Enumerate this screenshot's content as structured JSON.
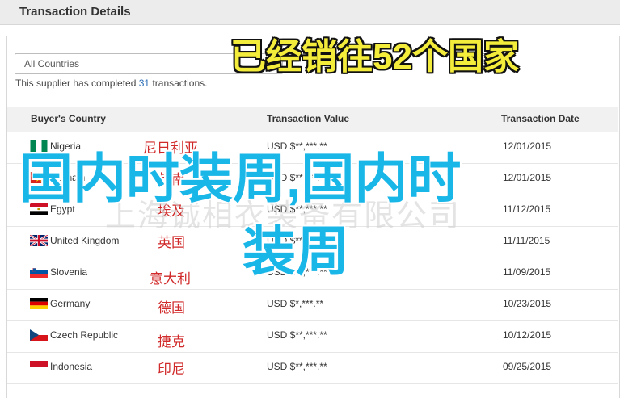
{
  "header": {
    "title": "Transaction Details"
  },
  "filter": {
    "selected": "All Countries"
  },
  "summary": {
    "prefix": "This supplier has completed ",
    "count": "31",
    "suffix": " transactions."
  },
  "table": {
    "columns": [
      "Buyer's Country",
      "Transaction Value",
      "Transaction Date"
    ],
    "rows": [
      {
        "country": "Nigeria",
        "value": "USD $**,***.**",
        "date": "12/01/2015",
        "cn": "尼日利亚",
        "flag": "nigeria-flag-icon"
      },
      {
        "country": "Vietnam",
        "value": "USD $**,***.**",
        "date": "12/01/2015",
        "cn": "越南",
        "flag": "vietnam-flag-icon"
      },
      {
        "country": "Egypt",
        "value": "USD $**,***.**",
        "date": "11/12/2015",
        "cn": "埃及",
        "flag": "egypt-flag-icon"
      },
      {
        "country": "United Kingdom",
        "value": "USD $**,***.**",
        "date": "11/11/2015",
        "cn": "英国",
        "flag": "uk-flag-icon"
      },
      {
        "country": "Slovenia",
        "value": "USD $**,***.**",
        "date": "11/09/2015",
        "cn": "意大利",
        "flag": "slovenia-flag-icon"
      },
      {
        "country": "Germany",
        "value": "USD $*,***.**",
        "date": "10/23/2015",
        "cn": "德国",
        "flag": "germany-flag-icon"
      },
      {
        "country": "Czech Republic",
        "value": "USD $**,***.**",
        "date": "10/12/2015",
        "cn": "捷克",
        "flag": "czech-flag-icon"
      },
      {
        "country": "Indonesia",
        "value": "USD $**,***.**",
        "date": "09/25/2015",
        "cn": "印尼",
        "flag": "indonesia-flag-icon"
      }
    ]
  },
  "overlays": {
    "top": "已经销往52个国家",
    "big_line1": "国内时装周,国内时",
    "big_line2": "装周",
    "watermark": "上海诚相衣装备有限公司"
  },
  "colors": {
    "link_blue": "#2b6db5",
    "overlay_yellow": "#f4ec3a",
    "overlay_cyan": "#19b6e8",
    "cn_red": "#d12a2a"
  }
}
